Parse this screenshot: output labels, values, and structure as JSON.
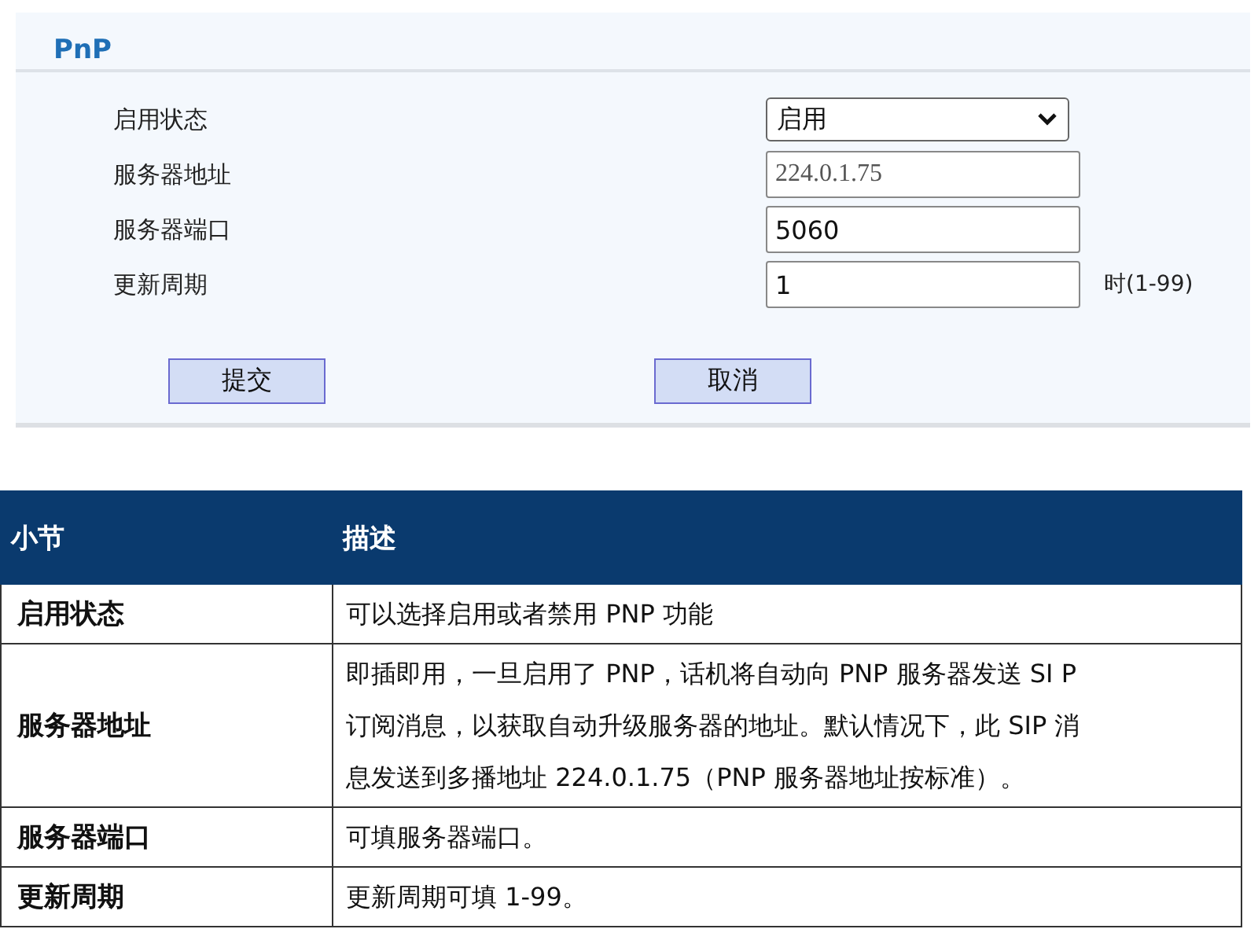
{
  "panel": {
    "title": "PnP",
    "fields": [
      {
        "kind": "select",
        "label": "启用状态",
        "value": "启用"
      },
      {
        "kind": "text",
        "label": "服务器地址",
        "value": "224.0.1.75",
        "disabled": true
      },
      {
        "kind": "text",
        "label": "服务器端口",
        "value": "5060",
        "disabled": false
      },
      {
        "kind": "text",
        "label": "更新周期",
        "value": "1",
        "disabled": false,
        "unit": "时(1-99)"
      }
    ],
    "buttons": [
      "提交",
      "取消"
    ]
  },
  "table": {
    "columns": [
      "小节",
      "描述"
    ],
    "rows": [
      {
        "section": "启用状态",
        "description": [
          "可以选择启用或者禁用 PNP 功能"
        ]
      },
      {
        "section": "服务器地址",
        "description": [
          "即插即用，一旦启用了 PNP，话机将自动向 PNP 服务器发送 SI P",
          "订阅消息，以获取自动升级服务器的地址。默认情况下，此 SIP 消",
          "息发送到多播地址 224.0.1.75（PNP 服务器地址按标准）。"
        ]
      },
      {
        "section": "服务器端口",
        "description": [
          "可填服务器端口。"
        ]
      },
      {
        "section": "更新周期",
        "description": [
          "更新周期可填 1-99。"
        ]
      }
    ]
  }
}
